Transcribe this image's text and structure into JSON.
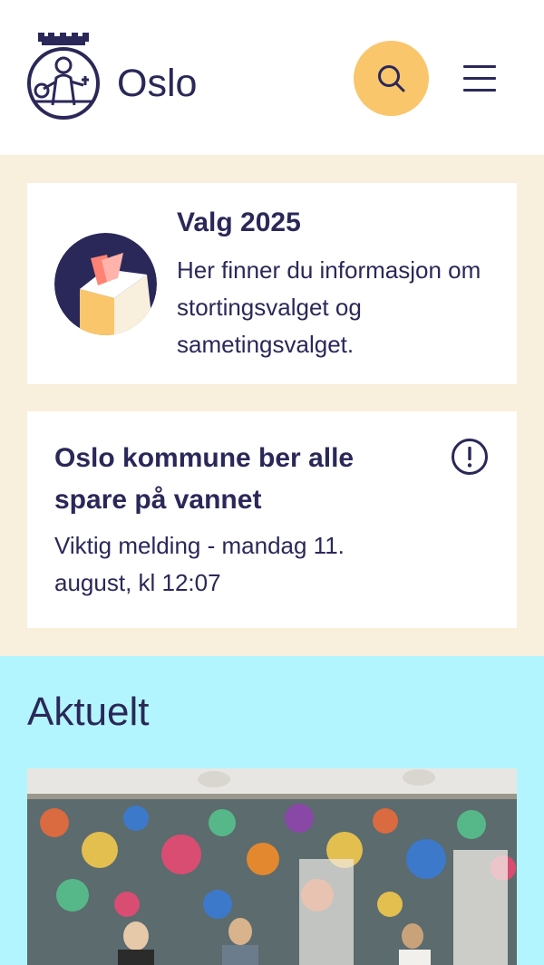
{
  "header": {
    "logo_text": "Oslo",
    "search_icon": "search-icon",
    "menu_icon": "hamburger-menu-icon"
  },
  "colors": {
    "primary": "#2a2859",
    "search_button": "#f9c66b",
    "notice_bg": "#f8f0dd",
    "news_bg": "#b3f5ff"
  },
  "election_card": {
    "title": "Valg 2025",
    "text": "Her finner du informasjon om stortingsvalget og sametingsvalget.",
    "illustration_icon": "ballot-box-icon"
  },
  "alert_card": {
    "title": "Oslo kommune ber alle spare på vannet",
    "meta": "Viktig melding - mandag 11. august, kl 12:07",
    "icon": "exclamation-circle-icon"
  },
  "news": {
    "heading": "Aktuelt"
  }
}
